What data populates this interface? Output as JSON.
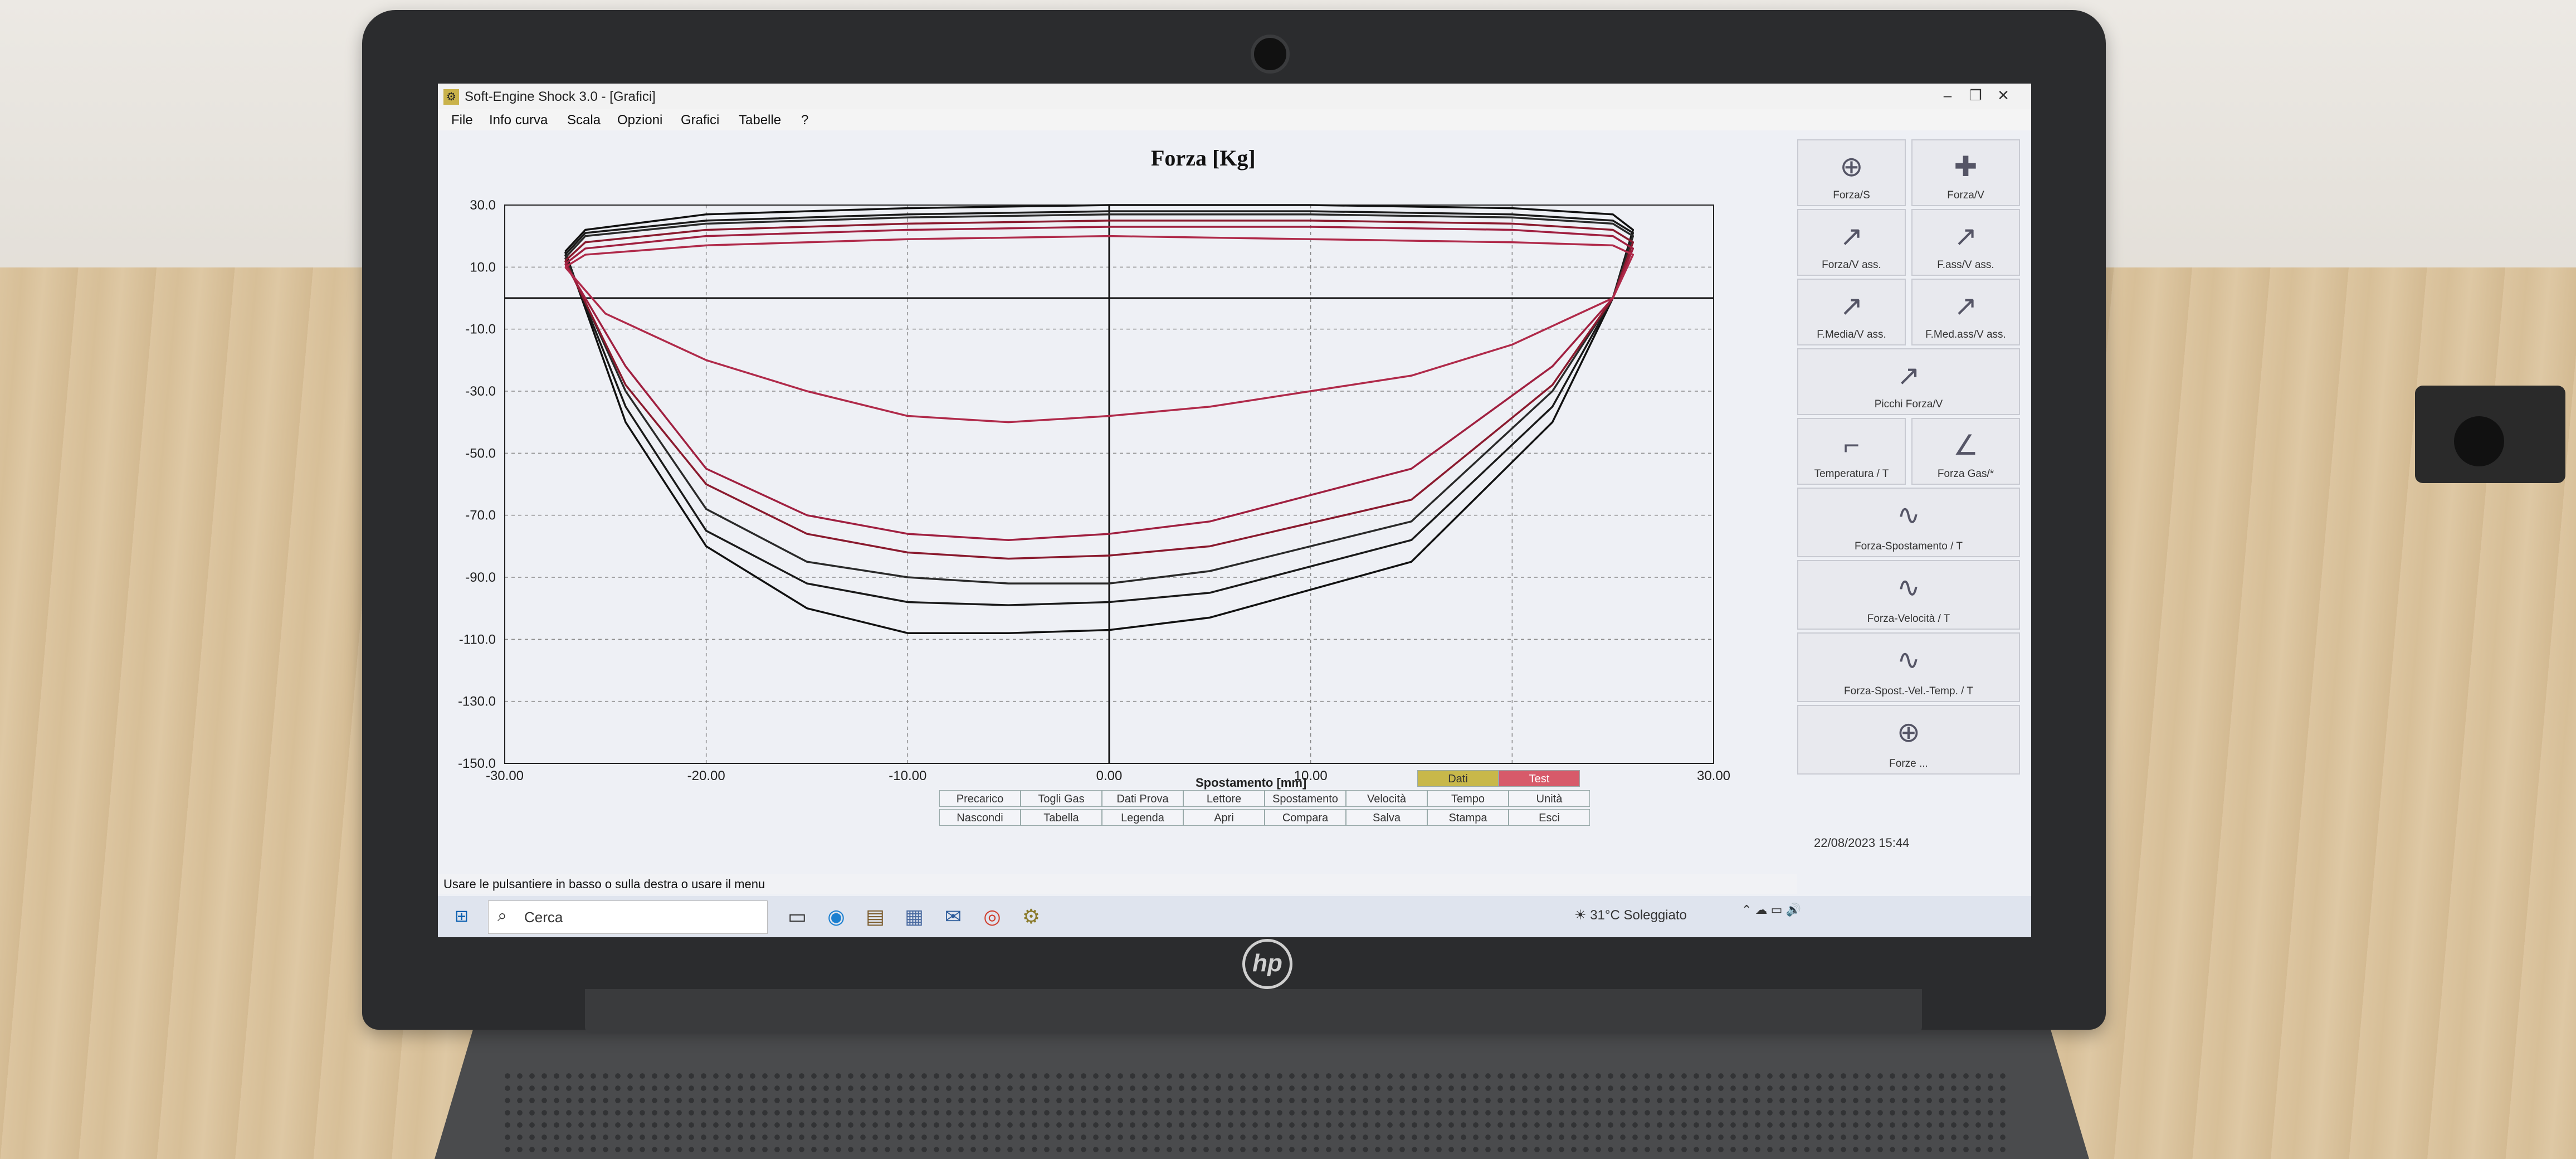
{
  "window": {
    "title": "Soft-Engine Shock 3.0 - [Grafici]",
    "minimize": "–",
    "restore": "❐",
    "close": "✕"
  },
  "menu": [
    "File",
    "Info curva",
    "Scala",
    "Opzioni",
    "Grafici",
    "Tabelle",
    "?"
  ],
  "chart_data": {
    "type": "line",
    "title": "Forza [Kg]",
    "xlabel": "Spostamento [mm]",
    "ylabel": "",
    "xlim": [
      -30,
      30
    ],
    "ylim": [
      -150,
      30
    ],
    "x_ticks": [
      "-30.00",
      "-20.00",
      "-10.00",
      "0.00",
      "10.00",
      "20.00",
      "30.00"
    ],
    "y_ticks": [
      "30.0",
      "10.0",
      "-10.0",
      "-30.0",
      "-50.0",
      "-70.0",
      "-90.0",
      "-110.0",
      "-130.0",
      "-150.0"
    ],
    "grid": true,
    "series": [
      {
        "color": "#111111",
        "x": [
          -27,
          -26,
          -20,
          -10,
          0,
          10,
          20,
          25,
          26,
          25,
          22,
          15,
          5,
          0,
          -5,
          -10,
          -15,
          -20,
          -24,
          -27
        ],
        "y": [
          15,
          22,
          27,
          29,
          30,
          30,
          29,
          27,
          22,
          0,
          -40,
          -85,
          -103,
          -107,
          -108,
          -108,
          -100,
          -80,
          -40,
          15
        ]
      },
      {
        "color": "#1a1a1a",
        "x": [
          -27,
          -26,
          -20,
          -10,
          0,
          10,
          20,
          25,
          26,
          25,
          22,
          15,
          5,
          0,
          -5,
          -10,
          -15,
          -20,
          -24,
          -27
        ],
        "y": [
          14,
          21,
          25,
          27,
          28,
          28,
          27,
          25,
          21,
          0,
          -35,
          -78,
          -95,
          -98,
          -99,
          -98,
          -92,
          -75,
          -35,
          14
        ]
      },
      {
        "color": "#2a2a2a",
        "x": [
          -27,
          -26,
          -20,
          -10,
          0,
          10,
          20,
          25,
          26,
          25,
          22,
          15,
          5,
          0,
          -5,
          -10,
          -15,
          -20,
          -24,
          -27
        ],
        "y": [
          13,
          20,
          24,
          26,
          27,
          27,
          26,
          24,
          20,
          0,
          -30,
          -72,
          -88,
          -92,
          -92,
          -90,
          -85,
          -68,
          -30,
          13
        ]
      },
      {
        "color": "#8a1a2e",
        "x": [
          -27,
          -26,
          -20,
          -10,
          0,
          10,
          20,
          25,
          26,
          25,
          22,
          15,
          5,
          0,
          -5,
          -10,
          -15,
          -20,
          -24,
          -27
        ],
        "y": [
          12,
          18,
          22,
          24,
          25,
          25,
          24,
          22,
          18,
          0,
          -28,
          -65,
          -80,
          -83,
          -84,
          -82,
          -76,
          -60,
          -28,
          12
        ]
      },
      {
        "color": "#a02040",
        "x": [
          -27,
          -26,
          -20,
          -10,
          0,
          10,
          20,
          25,
          26,
          25,
          22,
          15,
          5,
          0,
          -5,
          -10,
          -15,
          -20,
          -24,
          -27
        ],
        "y": [
          11,
          16,
          20,
          22,
          23,
          23,
          22,
          20,
          16,
          0,
          -22,
          -55,
          -72,
          -76,
          -78,
          -76,
          -70,
          -55,
          -22,
          11
        ]
      },
      {
        "color": "#b02a4a",
        "x": [
          -27,
          -26,
          -20,
          -10,
          0,
          10,
          20,
          25,
          26,
          25,
          20,
          15,
          10,
          5,
          0,
          -5,
          -10,
          -15,
          -20,
          -25,
          -27
        ],
        "y": [
          10,
          14,
          17,
          19,
          20,
          19,
          18,
          17,
          14,
          0,
          -15,
          -25,
          -30,
          -35,
          -38,
          -40,
          -38,
          -30,
          -20,
          -5,
          10
        ]
      }
    ]
  },
  "right_panel": {
    "buttons": [
      {
        "label": "Forza/S",
        "icon": "⊕"
      },
      {
        "label": "Forza/V",
        "icon": "✚"
      },
      {
        "label": "Forza/V ass.",
        "icon": "↗"
      },
      {
        "label": "F.ass/V ass.",
        "icon": "↗"
      },
      {
        "label": "F.Media/V ass.",
        "icon": "↗"
      },
      {
        "label": "F.Med.ass/V ass.",
        "icon": "↗"
      },
      {
        "label": "Picchi Forza/V",
        "icon": "↗"
      },
      {
        "label": "Temperatura / T",
        "icon": "⌐"
      },
      {
        "label": "Forza Gas/*",
        "icon": "∠"
      },
      {
        "label": "Forza-Spostamento / T",
        "icon": "∿"
      },
      {
        "label": "Forza-Velocità / T",
        "icon": "∿"
      },
      {
        "label": "Forza-Spost.-Vel.-Temp. / T",
        "icon": "∿"
      },
      {
        "label": "Forze ...",
        "icon": "⊕"
      }
    ]
  },
  "bottom": {
    "row_top": [
      "Dati",
      "Test"
    ],
    "row1": [
      "Precarico",
      "Togli Gas",
      "Dati Prova",
      "Lettore",
      "Spostamento",
      "Velocità",
      "Tempo",
      "Unità"
    ],
    "row2": [
      "Nascondi",
      "Tabella",
      "Legenda",
      "Apri",
      "Compara",
      "Salva",
      "Stampa",
      "Esci"
    ],
    "colors": {
      "dati": "#c8b84a",
      "test": "#d75a6a"
    }
  },
  "status": {
    "hint": "Usare le pulsantiere in basso o sulla destra o usare il menu",
    "datetime": "22/08/2023  15:44"
  },
  "taskbar": {
    "search_placeholder": "Cerca",
    "weather": "31°C  Soleggiato"
  }
}
